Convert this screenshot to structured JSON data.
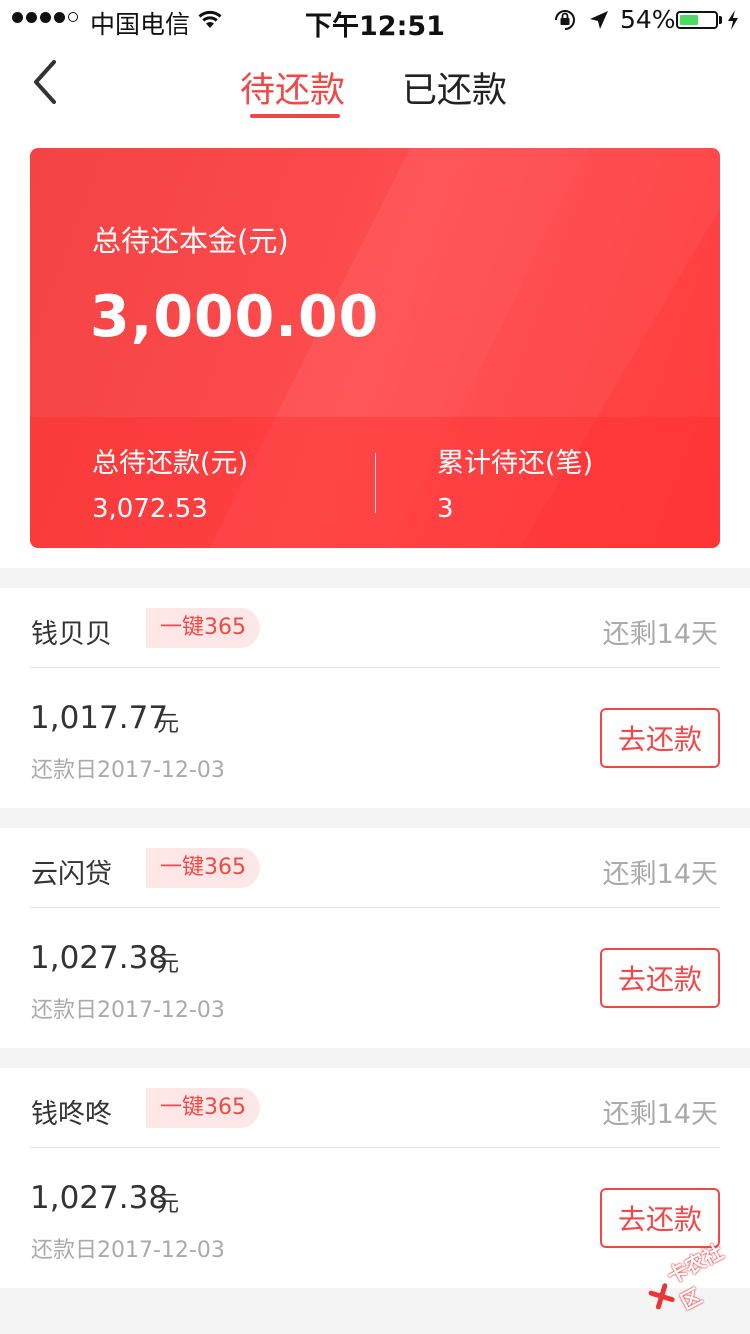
{
  "status_bar": {
    "carrier": "中国电信",
    "time": "下午12:51",
    "battery_percent": "54%",
    "battery_level": 0.54
  },
  "nav": {
    "tabs": [
      {
        "label": "待还款",
        "active": true
      },
      {
        "label": "已还款",
        "active": false
      }
    ]
  },
  "summary": {
    "principal_label": "总待还本金(元)",
    "principal_value": "3,000.00",
    "total_label": "总待还款(元)",
    "total_value": "3,072.53",
    "count_label": "累计待还(笔)",
    "count_value": "3"
  },
  "loans": [
    {
      "name": "钱贝贝",
      "tag": "一键365",
      "remaining": "还剩14天",
      "amount": "1,017.77",
      "unit": "元",
      "due_date": "还款日2017-12-03",
      "button": "去还款"
    },
    {
      "name": "云闪贷",
      "tag": "一键365",
      "remaining": "还剩14天",
      "amount": "1,027.38",
      "unit": "元",
      "due_date": "还款日2017-12-03",
      "button": "去还款"
    },
    {
      "name": "钱咚咚",
      "tag": "一键365",
      "remaining": "还剩14天",
      "amount": "1,027.38",
      "unit": "元",
      "due_date": "还款日2017-12-03",
      "button": "去还款"
    }
  ],
  "watermark": "卡农社区",
  "colors": {
    "accent": "#f04848",
    "card": "#ff4a4c",
    "tag_bg": "#fde7e7"
  }
}
